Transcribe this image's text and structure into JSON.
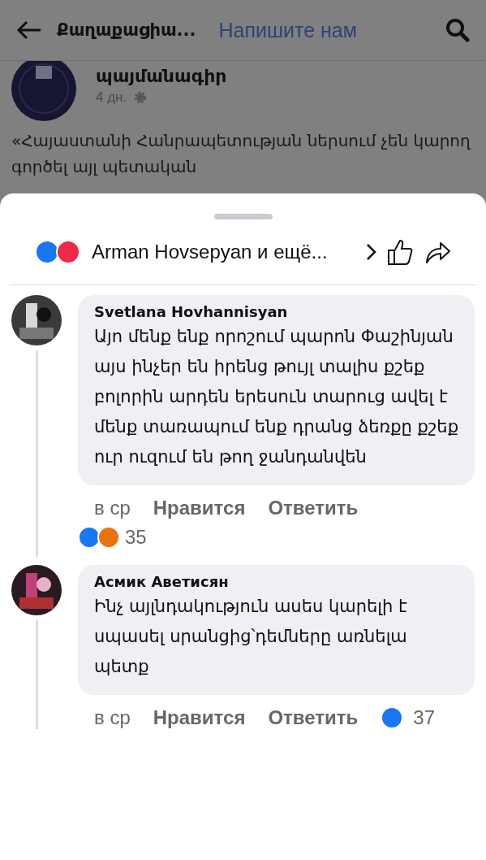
{
  "header": {
    "title": "Քաղաքացիա...",
    "link": "Напишите нам"
  },
  "post": {
    "author": "պայմանագիր",
    "time": "4 дн.",
    "text": "«Հայաստանի Հանրապետության ներսում չեն կարող գործել այլ պետական"
  },
  "reactions_bar": {
    "reactions": [
      {
        "kind": "like"
      },
      {
        "kind": "love"
      }
    ],
    "summary": "Arman Hovsepyan и ещё..."
  },
  "comments": [
    {
      "author": "Svetlana Hovhannisyan",
      "text": "Այո մենք ենք որոշում պարոն Փաշինյան այս ինչեր են իրենց թույլ տալիս քշեք բոլորին արդեն երեսուն տարուց ավել է մենք տառապում ենք դրանց ձեռքը քշեք ուր ուզում են թող ջանդանվեն",
      "time": "в ср",
      "like_label": "Нравится",
      "reply_label": "Ответить",
      "reactions_inline": false,
      "reactions": [
        {
          "kind": "like"
        },
        {
          "kind": "angry"
        }
      ],
      "count": "35"
    },
    {
      "author": "Асмик Аветисян",
      "text": "Ինչ այլնդակություն ասես կարելի է սպասել սրանցից՝դեմները առնելա պետք",
      "time": "в ср",
      "like_label": "Нравится",
      "reply_label": "Ответить",
      "reactions_inline": true,
      "reactions": [
        {
          "kind": "like"
        }
      ],
      "count": "37"
    }
  ]
}
